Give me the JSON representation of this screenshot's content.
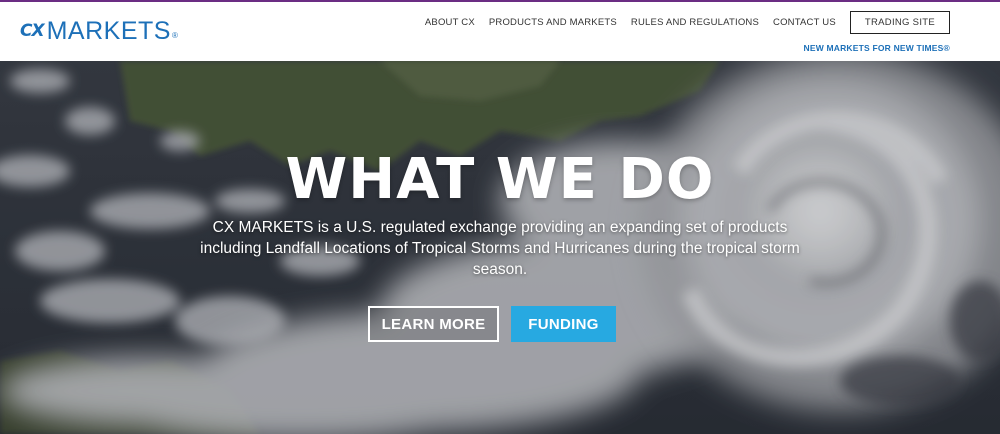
{
  "brand": {
    "cx": "CX",
    "name": "MARKETS",
    "reg": "®",
    "color": "#1d70b8"
  },
  "nav": {
    "items": [
      {
        "label": "ABOUT CX"
      },
      {
        "label": "PRODUCTS AND MARKETS"
      },
      {
        "label": "RULES AND REGULATIONS"
      },
      {
        "label": "CONTACT US"
      }
    ],
    "trading_site": "TRADING SITE"
  },
  "tagline": "NEW MARKETS FOR NEW TIMES®",
  "hero": {
    "title": "WHAT WE DO",
    "description": "CX MARKETS is a U.S. regulated exchange providing an expanding set of products including Landfall Locations of Tropical Storms and Hurricanes during the tropical storm season.",
    "learn_more": "LEARN MORE",
    "funding": "FUNDING",
    "funding_color": "#27a9e1",
    "background": "satellite-hurricane-image"
  }
}
